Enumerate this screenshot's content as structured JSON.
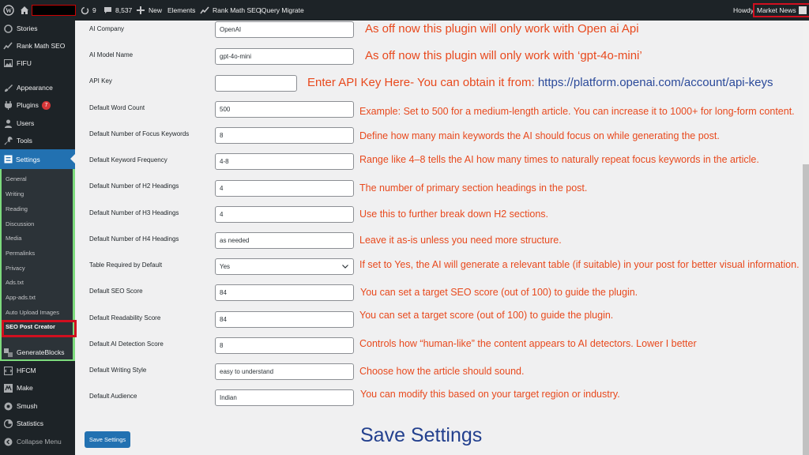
{
  "adminbar": {
    "comments_count": "9",
    "updates_count": "8,537",
    "new_label": "New",
    "elements_label": "Elements",
    "rankmath_label": "Rank Math SEO",
    "jquery_label": "jQuery Migrate",
    "howdy_label": "Howdy,",
    "user_name": "Market News"
  },
  "sidebar": {
    "items_top": [
      {
        "label": "Stories",
        "icon": "stories-icon"
      },
      {
        "label": "Rank Math SEO",
        "icon": "rankmath-icon"
      },
      {
        "label": "FIFU",
        "icon": "image-icon"
      }
    ],
    "appearance_label": "Appearance",
    "plugins_label": "Plugins",
    "plugins_badge": "7",
    "users_label": "Users",
    "tools_label": "Tools",
    "settings_label": "Settings",
    "settings_sub": [
      "General",
      "Writing",
      "Reading",
      "Discussion",
      "Media",
      "Permalinks",
      "Privacy",
      "Ads.txt",
      "App-ads.txt",
      "Auto Upload Images",
      "SEO Post Creator"
    ],
    "items_bottom": [
      {
        "label": "GenerateBlocks",
        "icon": "generateblocks-icon"
      },
      {
        "label": "HFCM",
        "icon": "hfcm-icon"
      },
      {
        "label": "Make",
        "icon": "make-icon"
      },
      {
        "label": "Smush",
        "icon": "smush-icon"
      },
      {
        "label": "Statistics",
        "icon": "statistics-icon"
      },
      {
        "label": "Collapse Menu",
        "icon": "collapse-icon"
      }
    ]
  },
  "form": {
    "fields": [
      {
        "label": "AI Company",
        "value": "OpenAI",
        "note": "As off now this plugin will only work with Open ai Api"
      },
      {
        "label": "AI Model Name",
        "value": "gpt-4o-mini",
        "note": "As off now this plugin will only work with ‘gpt-4o-mini’"
      },
      {
        "label": "API Key",
        "value": "",
        "note": "Enter API Key Here- You can obtain it from: ",
        "note_link": "https://platform.openai.com/account/api-keys"
      },
      {
        "label": "Default Word Count",
        "value": "500",
        "note": "Example: Set to 500 for a medium-length article. You can increase it to 1000+ for long-form content."
      },
      {
        "label": "Default Number of Focus Keywords",
        "value": "8",
        "note": "Define how many main keywords the AI should focus on while generating the post."
      },
      {
        "label": "Default Keyword Frequency",
        "value": "4-8",
        "note": "Range like 4–8 tells the AI how many times to naturally repeat focus keywords in the article."
      },
      {
        "label": "Default Number of H2 Headings",
        "value": "4",
        "note": "The number of primary section headings in the post."
      },
      {
        "label": "Default Number of H3 Headings",
        "value": "4",
        "note": "Use this to further break down H2 sections."
      },
      {
        "label": "Default Number of H4 Headings",
        "value": "as needed",
        "note": "Leave it as-is unless you need more structure."
      },
      {
        "label": "Table Required by Default",
        "value": "Yes",
        "note": "If set to Yes, the AI will generate a relevant table (if suitable) in your post for better visual information."
      },
      {
        "label": "Default SEO Score",
        "value": "84",
        "note": "You can set a target SEO score (out of 100) to guide the plugin."
      },
      {
        "label": "Default Readability Score",
        "value": "84",
        "note": "You can set a target score (out of 100) to guide the plugin."
      },
      {
        "label": "Default AI Detection Score",
        "value": "8",
        "note": "Controls how “human-like” the content appears to AI detectors. Lower I better"
      },
      {
        "label": "Default Writing Style",
        "value": "easy to understand",
        "note": "Choose how the article should sound."
      },
      {
        "label": "Default Audience",
        "value": "Indian",
        "note": "You can modify this based on your target region or industry."
      }
    ],
    "save_button": "Save Settings",
    "save_heading": "Save Settings"
  }
}
